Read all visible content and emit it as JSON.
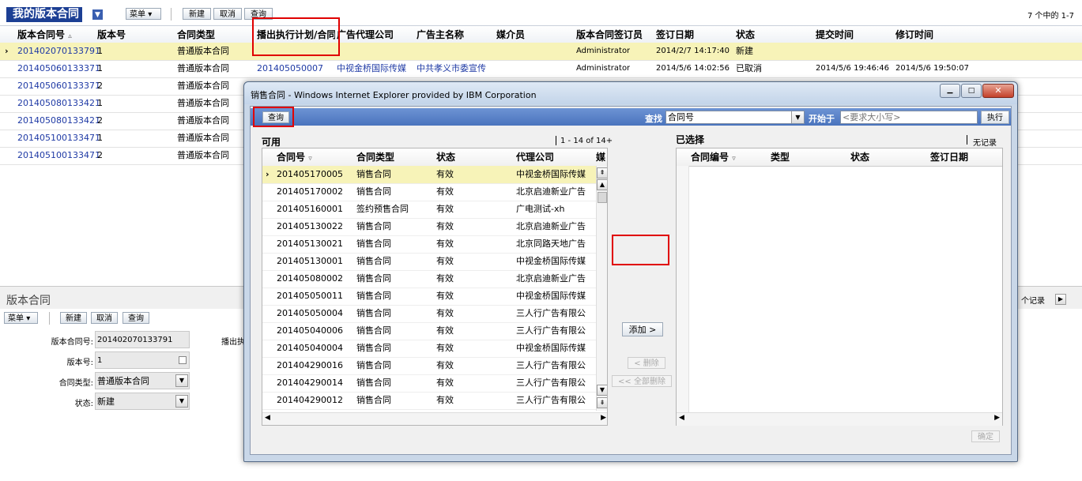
{
  "main": {
    "title": "我的版本合同",
    "menu_label": "菜单",
    "new_label": "新建",
    "cancel_label": "取消",
    "query_label": "查询",
    "record_count": "7 个中的  1-7",
    "columns": [
      "版本合同号",
      "版本号",
      "合同类型",
      "播出执行计划/合同",
      "广告代理公司",
      "广告主名称",
      "媒介员",
      "版本合同签订员",
      "签订日期",
      "状态",
      "提交时间",
      "修订时间"
    ],
    "rows": [
      {
        "contract": "201402070133791",
        "version": "1",
        "type": "普通版本合同",
        "plan": "",
        "agency": "",
        "advertiser": "",
        "media": "",
        "signer": "Administrator",
        "date": "2014/2/7 14:17:40",
        "status": "新建",
        "submitted": "",
        "revised": ""
      },
      {
        "contract": "201405060133371",
        "version": "1",
        "type": "普通版本合同",
        "plan": "201405050007",
        "agency": "中视金桥国际传媒",
        "advertiser": "中共孝义市委宣传",
        "media": "",
        "signer": "Administrator",
        "date": "2014/5/6 14:02:56",
        "status": "已取消",
        "submitted": "2014/5/6 19:46:46",
        "revised": "2014/5/6 19:50:07"
      },
      {
        "contract": "201405060133371",
        "version": "2",
        "type": "普通版本合同"
      },
      {
        "contract": "201405080133421",
        "version": "1",
        "type": "普通版本合同"
      },
      {
        "contract": "201405080133421",
        "version": "2",
        "type": "普通版本合同"
      },
      {
        "contract": "201405100133471",
        "version": "1",
        "type": "普通版本合同"
      },
      {
        "contract": "201405100133471",
        "version": "2",
        "type": "普通版本合同"
      }
    ]
  },
  "detail": {
    "title": "版本合同",
    "menu_label": "菜单",
    "new_label": "新建",
    "cancel_label": "取消",
    "query_label": "查询",
    "records_label": "个记录",
    "fields": {
      "contract_label": "版本合同号:",
      "contract_value": "201402070133791",
      "version_label": "版本号:",
      "version_value": "1",
      "type_label": "合同类型:",
      "type_value": "普通版本合同",
      "status_label": "状态:",
      "status_value": "新建",
      "plan_label": "播出执"
    }
  },
  "dialog": {
    "window_title": "销售合同 - Windows Internet Explorer provided by IBM Corporation",
    "query_label": "查询",
    "find_label": "查找",
    "find_field_value": "合同号",
    "starts_with_label": "开始于",
    "search_placeholder": "<要求大小写>",
    "execute_label": "执行",
    "available_label": "可用",
    "available_count": "1 - 14 of 14+",
    "selected_label": "已选择",
    "no_records_label": "无记录",
    "available_columns": [
      "合同号",
      "合同类型",
      "状态",
      "代理公司",
      "媒"
    ],
    "selected_columns": [
      "合同编号",
      "类型",
      "状态",
      "签订日期"
    ],
    "add_label": "添加 >",
    "remove_label": "< 删除",
    "remove_all_label": "<< 全部删除",
    "ok_label": "确定",
    "rows": [
      {
        "no": "201405170005",
        "type": "销售合同",
        "status": "有效",
        "agency": "中视金桥国际传媒"
      },
      {
        "no": "201405170002",
        "type": "销售合同",
        "status": "有效",
        "agency": "北京启迪新业广告"
      },
      {
        "no": "201405160001",
        "type": "签约预售合同",
        "status": "有效",
        "agency": "广电测试-xh"
      },
      {
        "no": "201405130022",
        "type": "销售合同",
        "status": "有效",
        "agency": "北京启迪新业广告"
      },
      {
        "no": "201405130021",
        "type": "销售合同",
        "status": "有效",
        "agency": "北京同路天地广告"
      },
      {
        "no": "201405130001",
        "type": "销售合同",
        "status": "有效",
        "agency": "中视金桥国际传媒"
      },
      {
        "no": "201405080002",
        "type": "销售合同",
        "status": "有效",
        "agency": "北京启迪新业广告"
      },
      {
        "no": "201405050011",
        "type": "销售合同",
        "status": "有效",
        "agency": "中视金桥国际传媒"
      },
      {
        "no": "201405050004",
        "type": "销售合同",
        "status": "有效",
        "agency": "三人行广告有限公"
      },
      {
        "no": "201405040006",
        "type": "销售合同",
        "status": "有效",
        "agency": "三人行广告有限公"
      },
      {
        "no": "201405040004",
        "type": "销售合同",
        "status": "有效",
        "agency": "中视金桥国际传媒"
      },
      {
        "no": "201404290016",
        "type": "销售合同",
        "status": "有效",
        "agency": "三人行广告有限公"
      },
      {
        "no": "201404290014",
        "type": "销售合同",
        "status": "有效",
        "agency": "三人行广告有限公"
      },
      {
        "no": "201404290012",
        "type": "销售合同",
        "status": "有效",
        "agency": "三人行广告有限公"
      }
    ]
  },
  "colors": {
    "header_blue": "#1c3f94",
    "highlight_row": "#f7f3b8",
    "link": "#1f3aa5",
    "annotation_red": "#e00000",
    "dialog_band": "#5b83c8"
  }
}
